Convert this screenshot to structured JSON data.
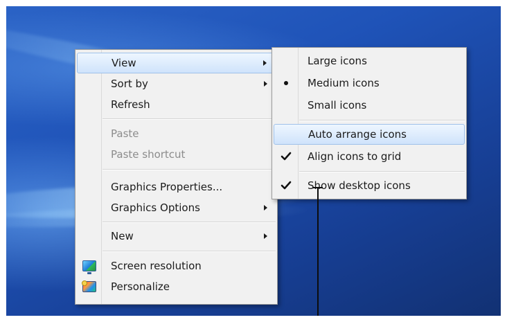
{
  "context_menu": {
    "items": [
      {
        "label": "View",
        "submenu": true,
        "disabled": false
      },
      {
        "label": "Sort by",
        "submenu": true,
        "disabled": false
      },
      {
        "label": "Refresh",
        "submenu": false,
        "disabled": false
      },
      {
        "label": "Paste",
        "submenu": false,
        "disabled": true
      },
      {
        "label": "Paste shortcut",
        "submenu": false,
        "disabled": true
      },
      {
        "label": "Graphics Properties...",
        "submenu": false,
        "disabled": false
      },
      {
        "label": "Graphics Options",
        "submenu": true,
        "disabled": false
      },
      {
        "label": "New",
        "submenu": true,
        "disabled": false
      },
      {
        "label": "Screen resolution",
        "submenu": false,
        "disabled": false,
        "icon": "display-icon"
      },
      {
        "label": "Personalize",
        "submenu": false,
        "disabled": false,
        "icon": "personalize-icon"
      }
    ]
  },
  "view_submenu": {
    "items": [
      {
        "label": "Large icons",
        "state": "none"
      },
      {
        "label": "Medium icons",
        "state": "radio"
      },
      {
        "label": "Small icons",
        "state": "none"
      },
      {
        "label": "Auto arrange icons",
        "state": "none"
      },
      {
        "label": "Align icons to grid",
        "state": "check"
      },
      {
        "label": "Show desktop icons",
        "state": "check"
      }
    ]
  },
  "icons": {
    "submenu_arrow": "chevron-right-icon",
    "radio": "radio-dot-icon",
    "check": "checkmark-icon",
    "screen_resolution": "display-icon",
    "personalize": "personalize-icon"
  },
  "colors": {
    "desktop_blue": "#1f53b8",
    "menu_background": "#f1f1f1",
    "highlight_border": "#9fc1ea",
    "highlight_fill": "#cfe3fb",
    "disabled_text": "#8c8c8c"
  }
}
